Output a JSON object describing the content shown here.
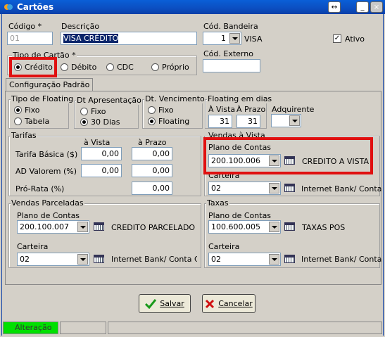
{
  "window": {
    "title": "Cartões",
    "restore_symbol": "↔",
    "minimize_symbol": "_",
    "maximize_symbol": "□",
    "close_symbol": "×"
  },
  "header": {
    "codigo_label": "Código *",
    "codigo_value": "01",
    "descricao_label": "Descrição",
    "descricao_value": "VISA CRÉDITO",
    "cod_bandeira_label": "Cód. Bandeira",
    "cod_bandeira_value": "1",
    "bandeira_name": "VISA",
    "ativo_label": "Ativo",
    "ativo_checked": true,
    "ativo_check_mark": "✓",
    "cod_externo_label": "Cód. Externo",
    "cod_externo_value": ""
  },
  "tipo_cartao": {
    "label": "Tipo de Cartão *",
    "options": [
      "Crédito",
      "Débito",
      "CDC",
      "Próprio"
    ],
    "selected": "Crédito"
  },
  "tabs": [
    {
      "label": "Configuração Padrão"
    }
  ],
  "floating_tipo": {
    "label": "Tipo de Floating",
    "options": [
      "Fixo",
      "Tabela"
    ],
    "selected": "Fixo"
  },
  "dt_apresentacao": {
    "label": "Dt Apresentação",
    "options": [
      "Fixo",
      "30 Dias"
    ],
    "selected": "30 Dias"
  },
  "dt_vencimento": {
    "label": "Dt. Vencimento",
    "options": [
      "Fixo",
      "Floating"
    ],
    "selected": "Floating"
  },
  "floating_dias": {
    "label": "Floating em dias",
    "a_vista_label": "À Vista",
    "a_vista_value": "31",
    "a_prazo_label": "À Prazo",
    "a_prazo_value": "31",
    "adquirente_label": "Adquirente",
    "adquirente_value": ""
  },
  "tarifas": {
    "label": "Tarifas",
    "col_avista": "à Vista",
    "col_aprazo": "à Prazo",
    "rows": [
      {
        "label": "Tarifa Básica ($)",
        "avista": "0,00",
        "aprazo": "0,00"
      },
      {
        "label": "AD Valorem (%)",
        "avista": "0,00",
        "aprazo": "0,00"
      },
      {
        "label": "Pró-Rata (%)",
        "aprazo": "0,00"
      }
    ]
  },
  "vendas_vista": {
    "label": "Vendas à Vista",
    "plano_label": "Plano de Contas",
    "plano_value": "200.100.006",
    "plano_desc": "CREDITO A VISTA",
    "carteira_label": "Carteira",
    "carteira_value": "02",
    "carteira_desc": "Internet Bank/ Conta"
  },
  "vendas_parceladas": {
    "label": "Vendas Parceladas",
    "plano_label": "Plano de Contas",
    "plano_value": "200.100.007",
    "plano_desc": "CREDITO PARCELADO",
    "carteira_label": "Carteira",
    "carteira_value": "02",
    "carteira_desc": "Internet Bank/ Conta Cor"
  },
  "taxas": {
    "label": "Taxas",
    "plano_label": "Plano de Contas",
    "plano_value": "100.600.005",
    "plano_desc": "TAXAS POS",
    "carteira_label": "Carteira",
    "carteira_value": "02",
    "carteira_desc": "Internet Bank/ Conta"
  },
  "buttons": {
    "salvar": "Salvar",
    "cancelar": "Cancelar"
  },
  "status": {
    "text": "Alteração",
    "color": "#00e000"
  }
}
